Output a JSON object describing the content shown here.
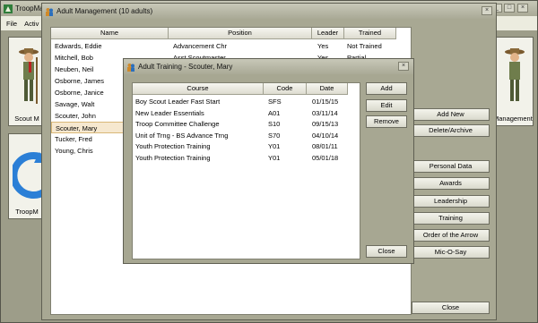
{
  "main_window": {
    "title": "TroopMa",
    "menu": [
      "File",
      "Activ"
    ],
    "tiles": [
      "Scout M",
      "TroopM",
      "Management"
    ]
  },
  "adult_management": {
    "title": "Adult Management (10 adults)",
    "columns": [
      "Name",
      "Position",
      "Leader",
      "Trained"
    ],
    "rows": [
      {
        "name": "Edwards, Eddie",
        "position": "Advancement Chr",
        "leader": "Yes",
        "trained": "Not Trained"
      },
      {
        "name": "Mitchell, Bob",
        "position": "Asst Scoutmaster",
        "leader": "Yes",
        "trained": "Partial"
      },
      {
        "name": "Neuben, Neil",
        "position": "",
        "leader": "",
        "trained": ""
      },
      {
        "name": "Osborne, James",
        "position": "",
        "leader": "",
        "trained": ""
      },
      {
        "name": "Osborne, Janice",
        "position": "",
        "leader": "",
        "trained": ""
      },
      {
        "name": "Savage, Walt",
        "position": "",
        "leader": "",
        "trained": ""
      },
      {
        "name": "Scouter, John",
        "position": "",
        "leader": "",
        "trained": ""
      },
      {
        "name": "Scouter, Mary",
        "position": "",
        "leader": "",
        "trained": ""
      },
      {
        "name": "Tucker, Fred",
        "position": "",
        "leader": "",
        "trained": ""
      },
      {
        "name": "Young, Chris",
        "position": "",
        "leader": "",
        "trained": ""
      }
    ],
    "selected_index": 7,
    "buttons": {
      "add_new": "Add New",
      "delete_archive": "Delete/Archive",
      "personal_data": "Personal Data",
      "awards": "Awards",
      "leadership": "Leadership",
      "training": "Training",
      "order_of_the_arrow": "Order of the Arrow",
      "mic_o_say": "Mic-O-Say",
      "close": "Close"
    }
  },
  "adult_training": {
    "title": "Adult Training - Scouter, Mary",
    "columns": [
      "Course",
      "Code",
      "Date"
    ],
    "rows": [
      {
        "course": "Boy Scout Leader Fast Start",
        "code": "SFS",
        "date": "01/15/15"
      },
      {
        "course": "New Leader Essentials",
        "code": "A01",
        "date": "03/11/14"
      },
      {
        "course": "Troop Committee Challenge",
        "code": "S10",
        "date": "09/15/13"
      },
      {
        "course": "Unit of Trng - BS Advance Trng",
        "code": "S70",
        "date": "04/10/14"
      },
      {
        "course": "Youth Protection Training",
        "code": "Y01",
        "date": "08/01/11"
      },
      {
        "course": "Youth Protection Training",
        "code": "Y01",
        "date": "05/01/18"
      }
    ],
    "buttons": {
      "add": "Add",
      "edit": "Edit",
      "remove": "Remove",
      "close": "Close"
    }
  }
}
